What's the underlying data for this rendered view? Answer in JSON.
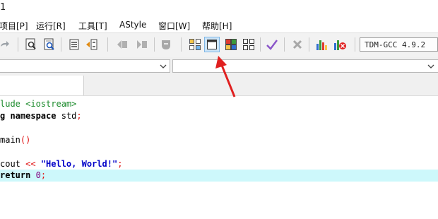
{
  "window": {
    "title_fragment": "1"
  },
  "menu": [
    {
      "label": "项目[P]"
    },
    {
      "label": "运行[R]"
    },
    {
      "label": "工具[T]"
    },
    {
      "label": "AStyle"
    },
    {
      "label": "窗口[W]"
    },
    {
      "label": "帮助[H]"
    }
  ],
  "toolbar": {
    "compiler_label": "TDM-GCC 4.9.2",
    "icons": [
      "redo-icon",
      "print-preview-icon",
      "find-icon",
      "indent-icon",
      "unindent-icon",
      "back-icon",
      "forward-icon",
      "bookmark-icon",
      "tile-windows-icon",
      "single-window-icon",
      "color-palette-icon",
      "grid-icon",
      "check-icon",
      "close-icon",
      "bar-chart-icon",
      "debug-icon"
    ]
  },
  "editor": {
    "lines": [
      {
        "segments": [
          {
            "cls": "pp",
            "text": "lude <iostream>"
          }
        ]
      },
      {
        "segments": [
          {
            "cls": "kw",
            "text": "g namespace "
          },
          {
            "cls": "plain",
            "text": "std"
          },
          {
            "cls": "op",
            "text": ";"
          }
        ]
      },
      {
        "segments": []
      },
      {
        "segments": [
          {
            "cls": "plain",
            "text": "main"
          },
          {
            "cls": "op",
            "text": "()"
          }
        ]
      },
      {
        "segments": []
      },
      {
        "segments": [
          {
            "cls": "plain",
            "text": "cout "
          },
          {
            "cls": "op",
            "text": "<< "
          },
          {
            "cls": "str",
            "text": "\"Hello, World!\""
          },
          {
            "cls": "op",
            "text": ";"
          }
        ]
      },
      {
        "segments": [
          {
            "cls": "kw",
            "text": "return "
          },
          {
            "cls": "num",
            "text": "0"
          },
          {
            "cls": "op",
            "text": ";"
          }
        ],
        "highlight": true
      }
    ]
  }
}
